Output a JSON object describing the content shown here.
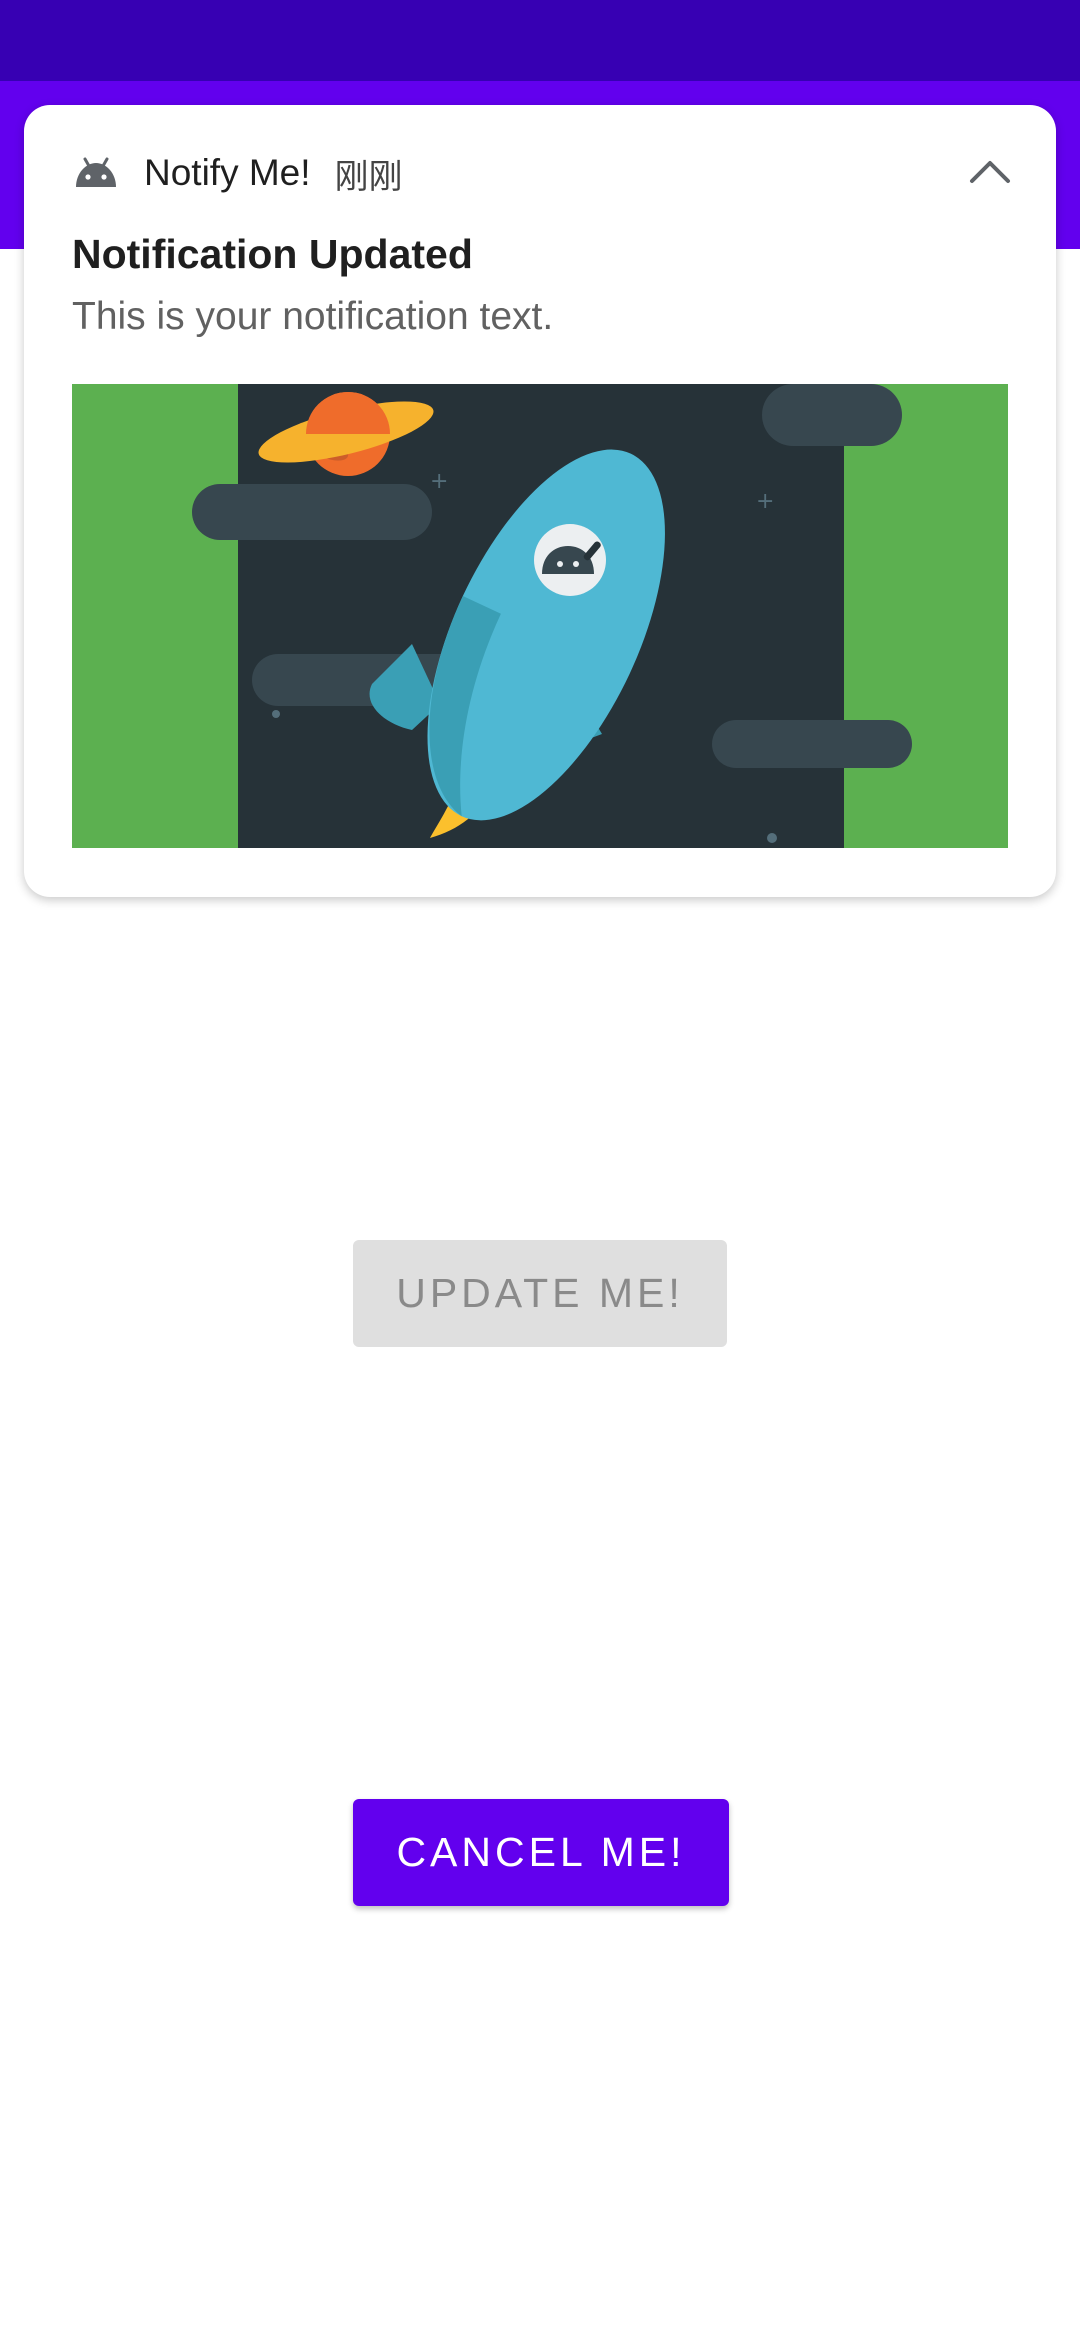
{
  "colors": {
    "status_bar": "#3700b3",
    "app_bar": "#6200ee",
    "primary_button": "#6200ee",
    "disabled_button": "#dfdfdf",
    "image_background": "#5cb050"
  },
  "notification": {
    "app_icon": "android-icon",
    "app_name": "Notify Me!",
    "timestamp": "刚刚",
    "expand_icon": "chevron-up-icon",
    "title": "Notification Updated",
    "text": "This is your notification text.",
    "image": "rocket-mascot-illustration"
  },
  "buttons": {
    "update_label": "UPDATE ME!",
    "update_enabled": false,
    "cancel_label": "CANCEL ME!",
    "cancel_enabled": true
  }
}
